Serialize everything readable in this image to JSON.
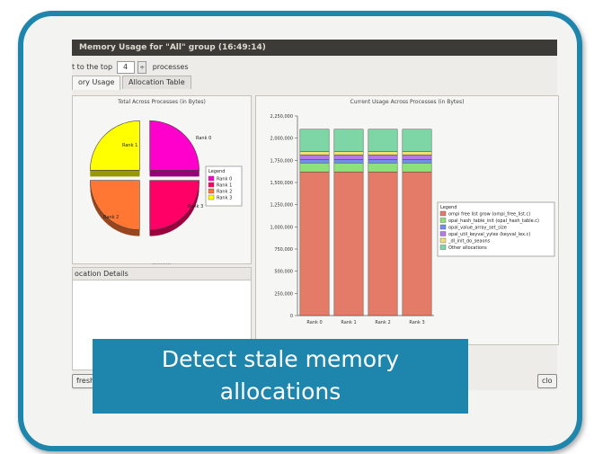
{
  "window": {
    "title": "Memory Usage for \"All\" group (16:49:14)"
  },
  "toolbar": {
    "limit_label": "t to the top",
    "limit_value": "4",
    "processes_label": "processes",
    "spin_glyph": "÷"
  },
  "tabs": [
    {
      "label": "ory Usage"
    },
    {
      "label": "Allocation Table"
    }
  ],
  "pie_panel": {
    "title": "Total Across Processes (in Bytes)"
  },
  "bar_panel": {
    "title": "Current Usage Across Processes (in Bytes)"
  },
  "details": {
    "label": "ocation Details"
  },
  "buttons": {
    "refresh": "fresh",
    "close": "clo"
  },
  "caption": {
    "line1": "Detect stale memory",
    "line2": "allocations"
  },
  "colors": {
    "accent": "#1e86ad",
    "rank0": "#ff00cc",
    "rank1": "#ff0066",
    "rank2": "#ff7733",
    "rank3": "#ffff00"
  },
  "chart_data": [
    {
      "type": "pie",
      "title": "Total Across Processes (in Bytes)",
      "legend": {
        "title": "Legend",
        "position": "right"
      },
      "slices": [
        {
          "name": "Rank 0",
          "value": 25,
          "color": "#ff00cc"
        },
        {
          "name": "Rank 1",
          "value": 25,
          "color": "#ff0066"
        },
        {
          "name": "Rank 2",
          "value": 25,
          "color": "#ff7733"
        },
        {
          "name": "Rank 3",
          "value": 25,
          "color": "#ffff00"
        }
      ],
      "slice_labels": [
        "Rank 0",
        "Rank 1",
        "Rank 2",
        "Rank 3"
      ]
    },
    {
      "type": "bar",
      "stacked": true,
      "title": "Current Usage Across Processes (in Bytes)",
      "categories": [
        "Rank 0",
        "Rank 1",
        "Rank 2",
        "Rank 3"
      ],
      "ylim": [
        0,
        2250000
      ],
      "yticks": [
        "0",
        "250,000",
        "500,000",
        "750,000",
        "1,000,000",
        "1,250,000",
        "1,500,000",
        "1,750,000",
        "2,000,000",
        "2,250,000"
      ],
      "grid": false,
      "legend": {
        "title": "Legend",
        "position": "right"
      },
      "series": [
        {
          "name": "ompi free list grow (ompi_free_list.c)",
          "color": "#e37b68",
          "values": [
            1620000,
            1620000,
            1620000,
            1620000
          ]
        },
        {
          "name": "opal_hash_table_init (opal_hash_table.c)",
          "color": "#8fe07a",
          "values": [
            100000,
            100000,
            100000,
            100000
          ]
        },
        {
          "name": "opal_value_array_set_size",
          "color": "#6e8ef0",
          "values": [
            40000,
            40000,
            40000,
            40000
          ]
        },
        {
          "name": "opal_util_keyval_yylex (keyval_lex.c)",
          "color": "#b37ae8",
          "values": [
            50000,
            50000,
            50000,
            50000
          ]
        },
        {
          "name": "_dl_init_do_seaons",
          "color": "#f1e070",
          "values": [
            40000,
            40000,
            40000,
            40000
          ]
        },
        {
          "name": "Other allocations",
          "color": "#7ed6a6",
          "values": [
            250000,
            250000,
            250000,
            250000
          ]
        }
      ]
    }
  ]
}
